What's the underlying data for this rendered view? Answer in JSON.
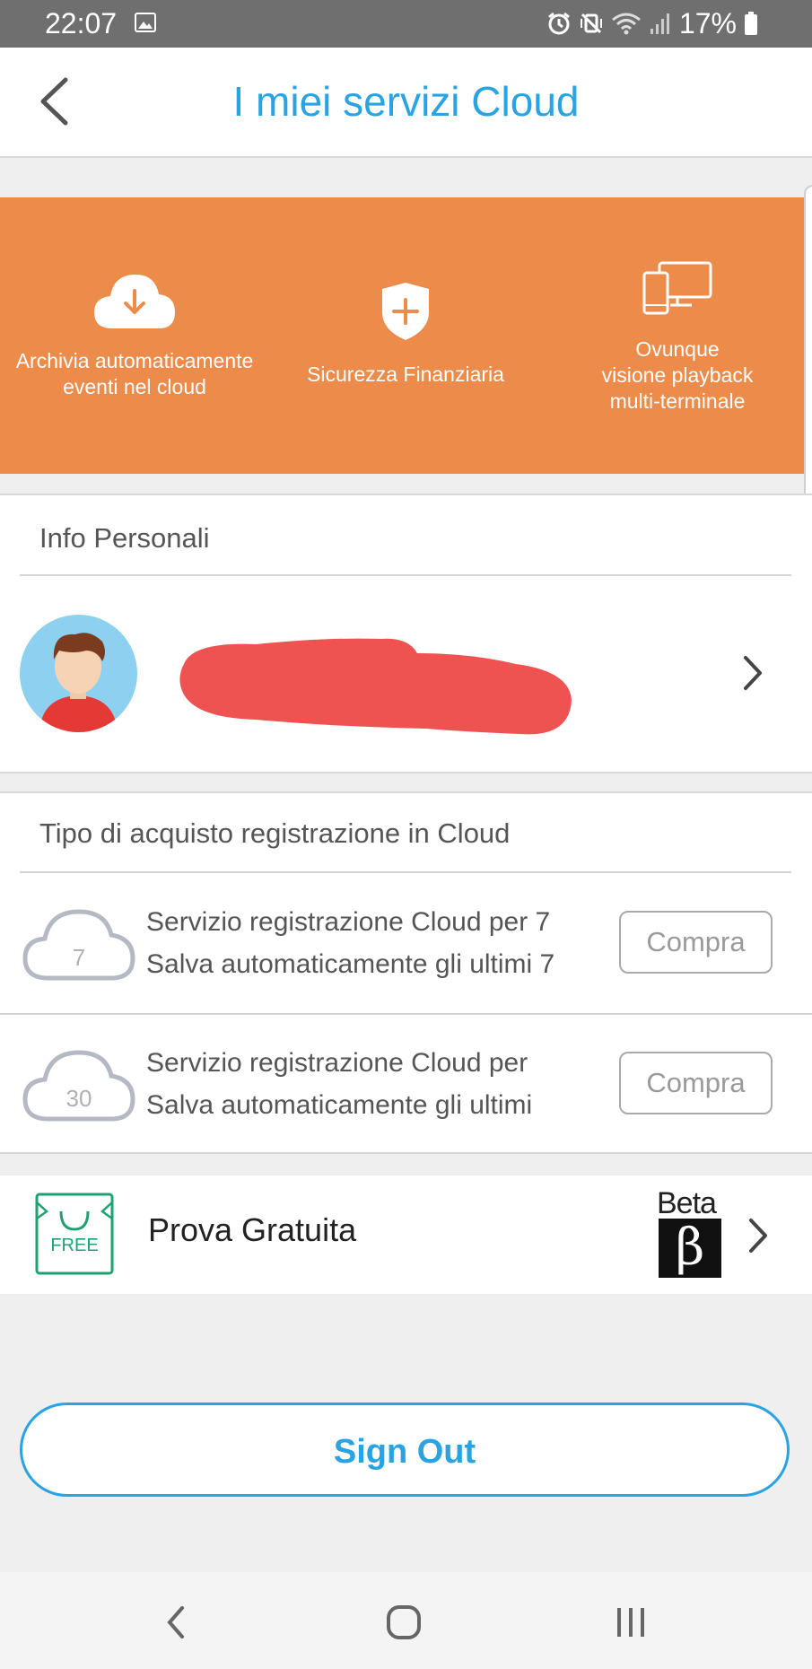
{
  "status_bar": {
    "time": "22:07",
    "battery_percent": "17%"
  },
  "header": {
    "title": "I miei servizi Cloud"
  },
  "banner": {
    "background": "#ec8b4a",
    "features": [
      {
        "icon": "cloud-download-icon",
        "lines": [
          "Archivia automaticamente",
          "eventi nel cloud"
        ]
      },
      {
        "icon": "shield-plus-icon",
        "lines": [
          "Sicurezza Finanziaria"
        ]
      },
      {
        "icon": "multi-device-icon",
        "lines": [
          "Ovunque",
          "visione playback",
          "multi-terminale"
        ]
      }
    ]
  },
  "personal": {
    "section_label": "Info Personali"
  },
  "purchase": {
    "section_label": "Tipo di acquisto registrazione in Cloud",
    "plans": [
      {
        "badge": "7",
        "line1": "Servizio registrazione Cloud per 7",
        "line2": "Salva automaticamente gli ultimi 7",
        "button": "Compra"
      },
      {
        "badge": "30",
        "line1": "Servizio registrazione Cloud per",
        "line2": "Salva automaticamente gli ultimi",
        "button": "Compra"
      }
    ]
  },
  "trial": {
    "label": "Prova Gratuita",
    "free_tag": "FREE",
    "beta_label": "Beta",
    "beta_symbol": "β"
  },
  "sign_out": "Sign Out",
  "colors": {
    "accent": "#2aa3e3",
    "banner": "#ec8b4a"
  }
}
